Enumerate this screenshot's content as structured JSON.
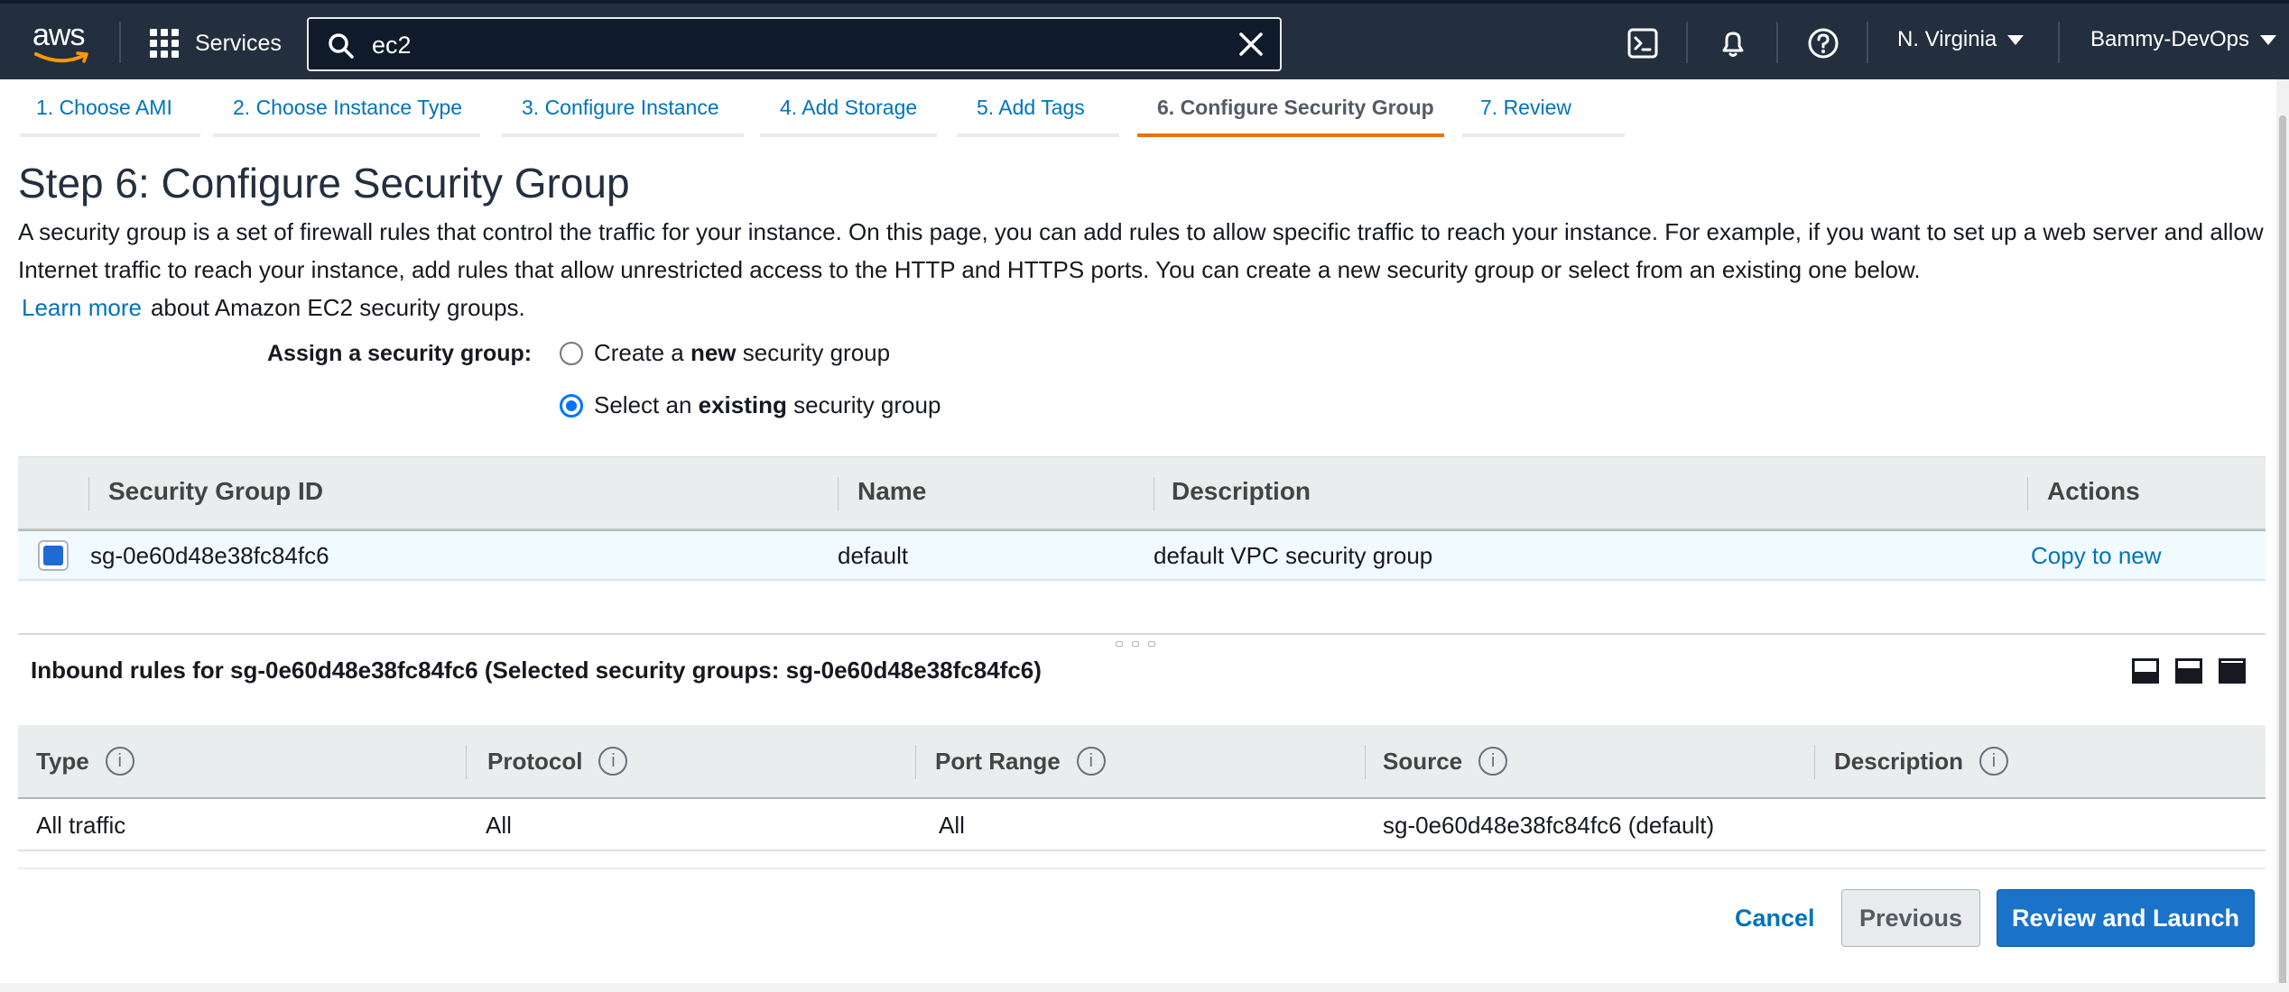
{
  "topnav": {
    "logo_text": "aws",
    "services_label": "Services",
    "search_value": "ec2",
    "region": "N. Virginia",
    "account": "Bammy-DevOps",
    "icons": [
      "cloudshell-icon",
      "bell-icon",
      "help-icon"
    ]
  },
  "tabs": [
    {
      "label": "1. Choose AMI"
    },
    {
      "label": "2. Choose Instance Type"
    },
    {
      "label": "3. Configure Instance"
    },
    {
      "label": "4. Add Storage"
    },
    {
      "label": "5. Add Tags"
    },
    {
      "label": "6. Configure Security Group",
      "active": true
    },
    {
      "label": "7. Review"
    }
  ],
  "page": {
    "title": "Step 6: Configure Security Group",
    "description": "A security group is a set of firewall rules that control the traffic for your instance. On this page, you can add rules to allow specific traffic to reach your instance. For example, if you want to set up a web server and allow Internet traffic to reach your instance, add rules that allow unrestricted access to the HTTP and HTTPS ports. You can create a new security group or select from an existing one below.",
    "learn_more": "Learn more",
    "learn_more_suffix": "about Amazon EC2 security groups."
  },
  "assign": {
    "label": "Assign a security group:",
    "option_new_prefix": "Create a",
    "option_new_bold": "new",
    "option_new_suffix": "security group",
    "option_existing_prefix": "Select an",
    "option_existing_bold": "existing",
    "option_existing_suffix": "security group",
    "selected": "existing"
  },
  "sg_table": {
    "headers": {
      "id": "Security Group ID",
      "name": "Name",
      "description": "Description",
      "actions": "Actions"
    },
    "rows": [
      {
        "id": "sg-0e60d48e38fc84fc6",
        "name": "default",
        "description": "default VPC security group",
        "action": "Copy to new",
        "checked": true
      }
    ]
  },
  "inbound": {
    "title": "Inbound rules for sg-0e60d48e38fc84fc6 (Selected security groups: sg-0e60d48e38fc84fc6)",
    "headers": {
      "type": "Type",
      "protocol": "Protocol",
      "port_range": "Port Range",
      "source": "Source",
      "description": "Description"
    },
    "info_glyph": "i",
    "rows": [
      {
        "type": "All traffic",
        "protocol": "All",
        "port_range": "All",
        "source": "sg-0e60d48e38fc84fc6 (default)",
        "description": ""
      }
    ]
  },
  "footer": {
    "cancel": "Cancel",
    "previous": "Previous",
    "review_launch": "Review and Launch"
  },
  "colors": {
    "nav_bg": "#232f3e",
    "link": "#0073bb",
    "active_tab": "#ec7211",
    "primary_button": "#1a73c9"
  }
}
